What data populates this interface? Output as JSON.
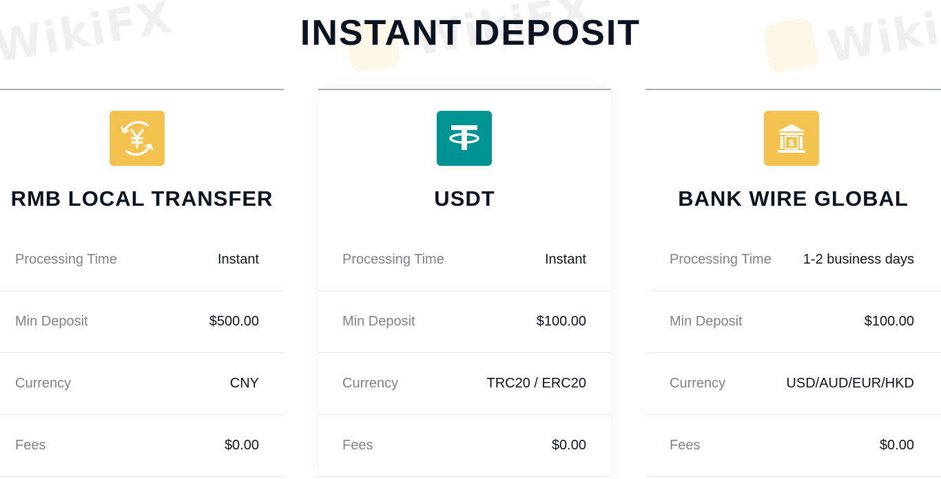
{
  "page": {
    "title": "INSTANT DEPOSIT"
  },
  "watermark": {
    "text": "WikiFX"
  },
  "colors": {
    "title": "#0b1421",
    "label": "#7c828b",
    "divider": "#e4e6ea",
    "icon_gold": "#f2c14e",
    "icon_teal": "#009393"
  },
  "methods": [
    {
      "title": "RMB LOCAL TRANSFER",
      "icon": "yuan-exchange-icon",
      "rows": [
        {
          "label": "Processing Time",
          "value": "Instant"
        },
        {
          "label": "Min Deposit",
          "value": "$500.00"
        },
        {
          "label": "Currency",
          "value": "CNY"
        },
        {
          "label": "Fees",
          "value": "$0.00"
        }
      ]
    },
    {
      "title": "USDT",
      "icon": "tether-icon",
      "rows": [
        {
          "label": "Processing Time",
          "value": "Instant"
        },
        {
          "label": "Min Deposit",
          "value": "$100.00"
        },
        {
          "label": "Currency",
          "value": "TRC20 / ERC20"
        },
        {
          "label": "Fees",
          "value": "$0.00"
        }
      ]
    },
    {
      "title": "BANK WIRE GLOBAL",
      "icon": "bank-icon",
      "rows": [
        {
          "label": "Processing Time",
          "value": "1-2 business days"
        },
        {
          "label": "Min Deposit",
          "value": "$100.00"
        },
        {
          "label": "Currency",
          "value": "USD/AUD/EUR/HKD"
        },
        {
          "label": "Fees",
          "value": "$0.00"
        }
      ]
    }
  ]
}
